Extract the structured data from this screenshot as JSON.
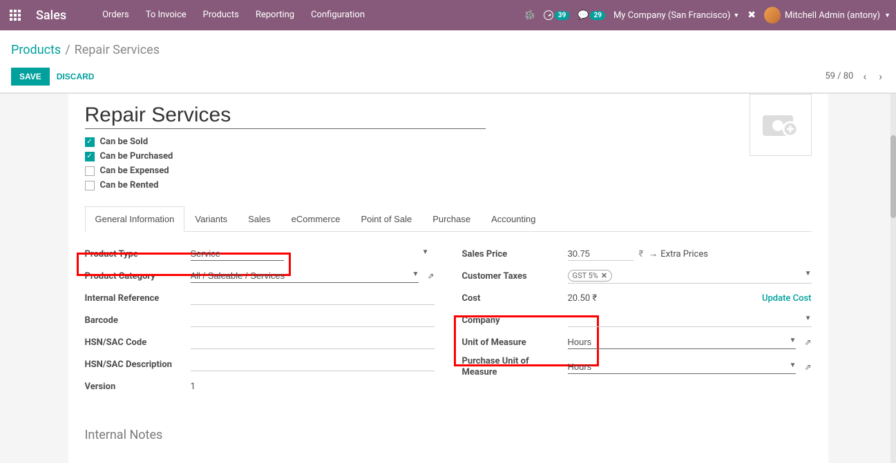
{
  "topbar": {
    "module": "Sales",
    "menu": [
      "Orders",
      "To Invoice",
      "Products",
      "Reporting",
      "Configuration"
    ],
    "notif_count": "39",
    "msg_count": "29",
    "company": "My Company (San Francisco)",
    "user": "Mitchell Admin (antony)"
  },
  "breadcrumb": {
    "parent": "Products",
    "current": "Repair Services"
  },
  "actions": {
    "save": "SAVE",
    "discard": "DISCARD"
  },
  "pager": {
    "pos": "59 / 80"
  },
  "form": {
    "title": "Repair Services",
    "checks": {
      "sold": {
        "label": "Can be Sold",
        "checked": true
      },
      "purchased": {
        "label": "Can be Purchased",
        "checked": true
      },
      "expensed": {
        "label": "Can be Expensed",
        "checked": false
      },
      "rented": {
        "label": "Can be Rented",
        "checked": false
      }
    },
    "tabs": [
      "General Information",
      "Variants",
      "Sales",
      "eCommerce",
      "Point of Sale",
      "Purchase",
      "Accounting"
    ],
    "left": {
      "product_type": {
        "label": "Product Type",
        "value": "Service"
      },
      "product_category": {
        "label": "Product Category",
        "value": "All / Saleable / Services"
      },
      "internal_ref": {
        "label": "Internal Reference",
        "value": ""
      },
      "barcode": {
        "label": "Barcode",
        "value": ""
      },
      "hsn_code": {
        "label": "HSN/SAC Code",
        "value": ""
      },
      "hsn_desc": {
        "label": "HSN/SAC Description",
        "value": ""
      },
      "version": {
        "label": "Version",
        "value": "1"
      }
    },
    "right": {
      "sales_price": {
        "label": "Sales Price",
        "value": "30.75",
        "currency": "₹",
        "extra": "Extra Prices"
      },
      "customer_taxes": {
        "label": "Customer Taxes",
        "tag": "GST 5%"
      },
      "cost": {
        "label": "Cost",
        "value": "20.50 ₹",
        "update": "Update Cost"
      },
      "company": {
        "label": "Company",
        "value": ""
      },
      "uom": {
        "label": "Unit of Measure",
        "value": "Hours"
      },
      "purchase_uom": {
        "label": "Purchase Unit of Measure",
        "value": "Hours"
      }
    },
    "notes_title": "Internal Notes"
  }
}
